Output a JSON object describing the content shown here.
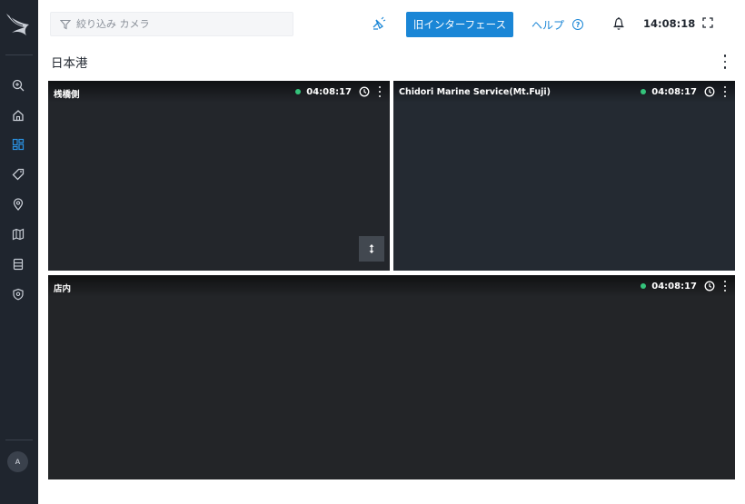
{
  "topbar": {
    "search_placeholder": "絞り込み カメラ",
    "legacy_button": "旧インターフェース",
    "help_label": "ヘルプ",
    "help_icon_glyph": "?",
    "clock": "14:08:18"
  },
  "page": {
    "title": "日本港"
  },
  "colors": {
    "sidebar_bg": "#1f252e",
    "accent": "#1a86d6",
    "live": "#34c37b"
  },
  "sidebar": {
    "items": [
      {
        "icon": "zoom-icon"
      },
      {
        "icon": "home-icon"
      },
      {
        "icon": "dashboard-icon",
        "active": true
      },
      {
        "icon": "tag-icon"
      },
      {
        "icon": "location-pin-icon"
      },
      {
        "icon": "map-icon"
      },
      {
        "icon": "storage-icon"
      },
      {
        "icon": "shield-pin-icon"
      }
    ],
    "avatar_glyph": "ᴀ"
  },
  "cameras": [
    {
      "name": "桟橋側",
      "time": "04:08:17",
      "live": true,
      "has_ptz": true
    },
    {
      "name": "Chidori Marine Service(Mt.Fuji)",
      "time": "04:08:17",
      "live": true
    },
    {
      "name": "店内",
      "time": "04:08:17",
      "live": true
    }
  ]
}
